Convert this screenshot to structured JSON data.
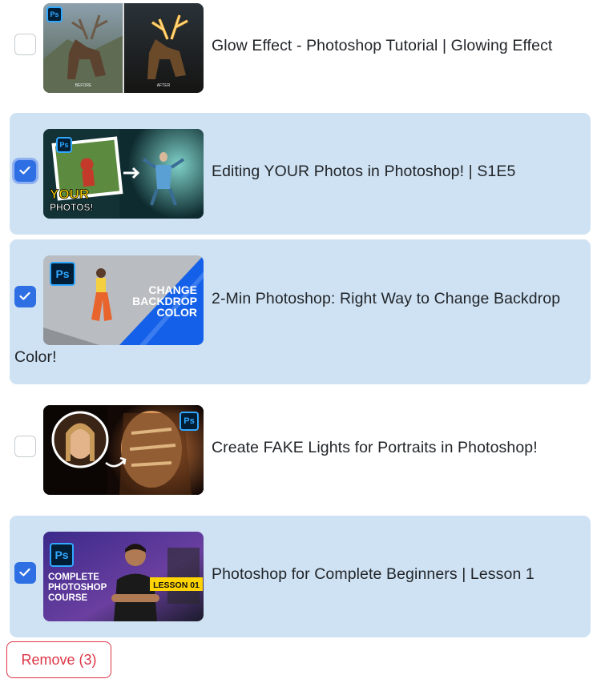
{
  "items": [
    {
      "title": "Glow Effect - Photoshop Tutorial | Glowing Effect",
      "checked": false,
      "thumb": {
        "before": "BEFORE",
        "after": "AFTER"
      }
    },
    {
      "title": "Editing YOUR Photos in Photoshop! | S1E5",
      "checked": true,
      "thumb": {
        "line1": "YOUR",
        "line2": "PHOTOS!"
      }
    },
    {
      "title_line1": "2-Min Photoshop: Right Way to Change Backdrop",
      "title_line2": "Color!",
      "checked": true,
      "thumb": {
        "line1": "CHANGE",
        "line2": "BACKDROP",
        "line3": "COLOR"
      }
    },
    {
      "title": "Create FAKE Lights for Portraits in Photoshop!",
      "checked": false
    },
    {
      "title": "Photoshop for Complete Beginners | Lesson 1",
      "checked": true,
      "thumb": {
        "line1": "COMPLETE",
        "line2": "PHOTOSHOP",
        "line3": "COURSE",
        "badge": "LESSON 01"
      }
    }
  ],
  "ps_label": "Ps",
  "remove_label": "Remove (3)",
  "colors": {
    "selected_bg": "#cfe2f3",
    "accent": "#2f6fe4",
    "danger": "#dc3545"
  }
}
